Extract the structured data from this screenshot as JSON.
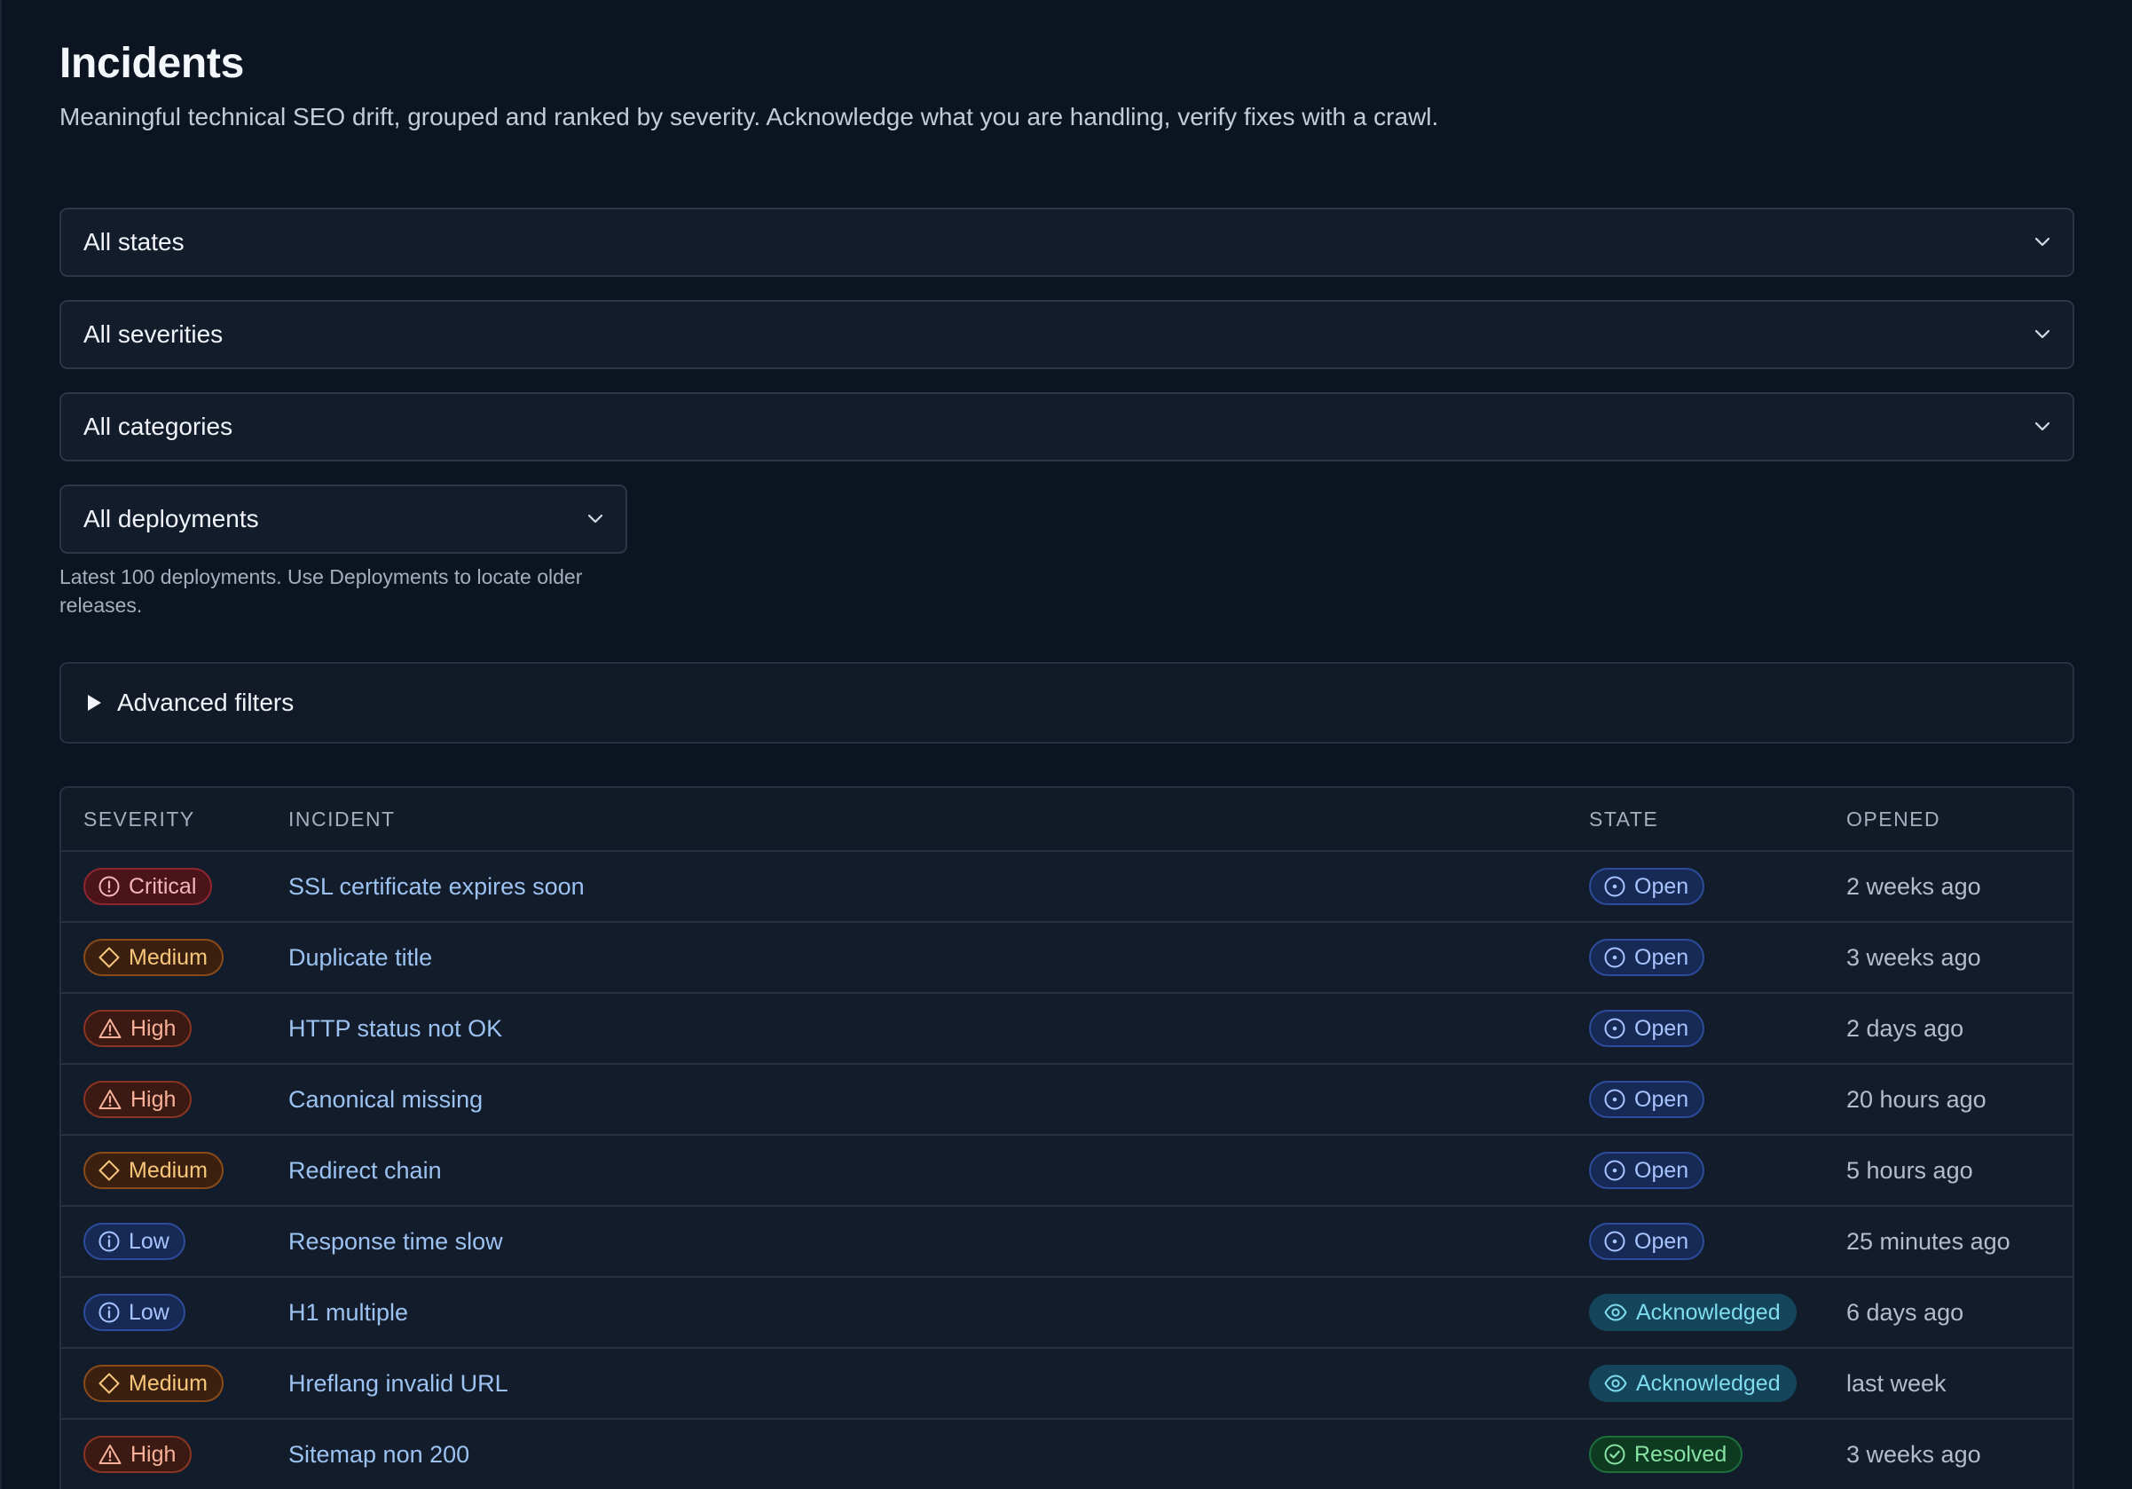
{
  "page": {
    "title": "Incidents",
    "subtitle": "Meaningful technical SEO drift, grouped and ranked by severity. Acknowledge what you are handling, verify fixes with a crawl."
  },
  "filters": {
    "states": "All states",
    "severities": "All severities",
    "categories": "All categories",
    "deployments": "All deployments",
    "deployments_help": "Latest 100 deployments. Use Deployments to locate older releases.",
    "advanced": "Advanced filters"
  },
  "table": {
    "headers": {
      "severity": "SEVERITY",
      "incident": "INCIDENT",
      "state": "STATE",
      "opened": "OPENED"
    },
    "rows": [
      {
        "severity": "Critical",
        "incident": "SSL certificate expires soon",
        "state": "Open",
        "opened": "2 weeks ago"
      },
      {
        "severity": "Medium",
        "incident": "Duplicate title",
        "state": "Open",
        "opened": "3 weeks ago"
      },
      {
        "severity": "High",
        "incident": "HTTP status not OK",
        "state": "Open",
        "opened": "2 days ago"
      },
      {
        "severity": "High",
        "incident": "Canonical missing",
        "state": "Open",
        "opened": "20 hours ago"
      },
      {
        "severity": "Medium",
        "incident": "Redirect chain",
        "state": "Open",
        "opened": "5 hours ago"
      },
      {
        "severity": "Low",
        "incident": "Response time slow",
        "state": "Open",
        "opened": "25 minutes ago"
      },
      {
        "severity": "Low",
        "incident": "H1 multiple",
        "state": "Acknowledged",
        "opened": "6 days ago"
      },
      {
        "severity": "Medium",
        "incident": "Hreflang invalid URL",
        "state": "Acknowledged",
        "opened": "last week"
      },
      {
        "severity": "High",
        "incident": "Sitemap non 200",
        "state": "Resolved",
        "opened": "3 weeks ago"
      }
    ]
  },
  "icons": {
    "critical": "alert-circle-icon",
    "high": "warning-triangle-icon",
    "medium": "diamond-icon",
    "low": "info-circle-icon",
    "open": "circle-dot-icon",
    "acknowledged": "eye-icon",
    "resolved": "check-circle-icon",
    "select": "chevron-down-icon"
  },
  "colors": {
    "background": "#0d1421",
    "link": "#9cc2f2",
    "critical": "#f4b4ba",
    "high": "#f9b199",
    "medium": "#f8c77b",
    "low": "#a8c4ff",
    "acknowledged": "#7fdcef",
    "resolved": "#86e3a4"
  }
}
